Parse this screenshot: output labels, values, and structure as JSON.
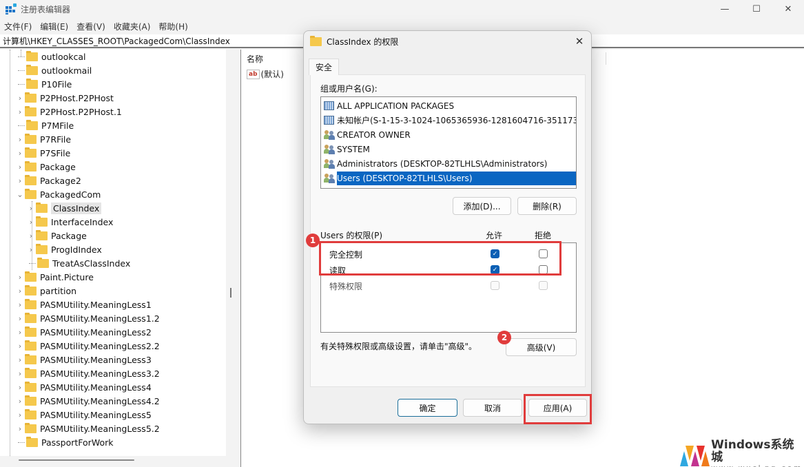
{
  "window": {
    "title": "注册表编辑器",
    "controls": {
      "minimize": "—",
      "maximize": "☐",
      "close": "✕"
    }
  },
  "menu": [
    "文件(F)",
    "编辑(E)",
    "查看(V)",
    "收藏夹(A)",
    "帮助(H)"
  ],
  "address": "计算机\\HKEY_CLASSES_ROOT\\PackagedCom\\ClassIndex",
  "tree": {
    "items": [
      {
        "label": "outlookcal",
        "level": 0,
        "expandable": false
      },
      {
        "label": "outlookmail",
        "level": 0,
        "expandable": false
      },
      {
        "label": "P10File",
        "level": 0,
        "expandable": false
      },
      {
        "label": "P2PHost.P2PHost",
        "level": 0,
        "expandable": true
      },
      {
        "label": "P2PHost.P2PHost.1",
        "level": 0,
        "expandable": true
      },
      {
        "label": "P7MFile",
        "level": 0,
        "expandable": false
      },
      {
        "label": "P7RFile",
        "level": 0,
        "expandable": true
      },
      {
        "label": "P7SFile",
        "level": 0,
        "expandable": true
      },
      {
        "label": "Package",
        "level": 0,
        "expandable": true
      },
      {
        "label": "Package2",
        "level": 0,
        "expandable": true
      },
      {
        "label": "PackagedCom",
        "level": 0,
        "expandable": true,
        "expanded": true
      },
      {
        "label": "ClassIndex",
        "level": 1,
        "expandable": true,
        "selected": true
      },
      {
        "label": "InterfaceIndex",
        "level": 1,
        "expandable": true
      },
      {
        "label": "Package",
        "level": 1,
        "expandable": true
      },
      {
        "label": "ProgIdIndex",
        "level": 1,
        "expandable": true
      },
      {
        "label": "TreatAsClassIndex",
        "level": 1,
        "expandable": false
      },
      {
        "label": "Paint.Picture",
        "level": 0,
        "expandable": true
      },
      {
        "label": "partition",
        "level": 0,
        "expandable": true
      },
      {
        "label": "PASMUtility.MeaningLess1",
        "level": 0,
        "expandable": true
      },
      {
        "label": "PASMUtility.MeaningLess1.2",
        "level": 0,
        "expandable": true
      },
      {
        "label": "PASMUtility.MeaningLess2",
        "level": 0,
        "expandable": true
      },
      {
        "label": "PASMUtility.MeaningLess2.2",
        "level": 0,
        "expandable": true
      },
      {
        "label": "PASMUtility.MeaningLess3",
        "level": 0,
        "expandable": true
      },
      {
        "label": "PASMUtility.MeaningLess3.2",
        "level": 0,
        "expandable": true
      },
      {
        "label": "PASMUtility.MeaningLess4",
        "level": 0,
        "expandable": true
      },
      {
        "label": "PASMUtility.MeaningLess4.2",
        "level": 0,
        "expandable": true
      },
      {
        "label": "PASMUtility.MeaningLess5",
        "level": 0,
        "expandable": true
      },
      {
        "label": "PASMUtility.MeaningLess5.2",
        "level": 0,
        "expandable": true
      },
      {
        "label": "PassportForWork",
        "level": 0,
        "expandable": false
      }
    ]
  },
  "values_pane": {
    "column_name": "名称",
    "rows": [
      {
        "icon": "ab",
        "name": "(默认)"
      }
    ]
  },
  "dialog": {
    "title": "ClassIndex 的权限",
    "close": "✕",
    "tab": "安全",
    "group_label": "组或用户名(G):",
    "users": [
      {
        "name": "ALL APPLICATION PACKAGES",
        "icon": "package-icon"
      },
      {
        "name": "未知帐户(S-1-15-3-1024-1065365936-1281604716-351173...",
        "icon": "package-icon"
      },
      {
        "name": "CREATOR OWNER",
        "icon": "group-icon"
      },
      {
        "name": "SYSTEM",
        "icon": "group-icon"
      },
      {
        "name": "Administrators (DESKTOP-82TLHLS\\Administrators)",
        "icon": "group-icon"
      },
      {
        "name": "Users (DESKTOP-82TLHLS\\Users)",
        "icon": "group-icon",
        "selected": true
      }
    ],
    "add_button": "添加(D)...",
    "remove_button": "删除(R)",
    "perm_label": "Users 的权限(P)",
    "allow_header": "允许",
    "deny_header": "拒绝",
    "permissions": [
      {
        "name": "完全控制",
        "allow": true,
        "deny": false,
        "disabled": false
      },
      {
        "name": "读取",
        "allow": true,
        "deny": false,
        "disabled": false
      },
      {
        "name": "特殊权限",
        "allow": false,
        "deny": false,
        "disabled": true
      }
    ],
    "advanced_hint": "有关特殊权限或高级设置，请单击\"高级\"。",
    "advanced_button": "高级(V)",
    "ok_button": "确定",
    "cancel_button": "取消",
    "apply_button": "应用(A)"
  },
  "annotations": {
    "badge1": "1",
    "badge2": "2",
    "highlight_color": "#e03c3c"
  },
  "watermark": {
    "title": "Windows系统城",
    "url": "www.wxcLgg.com"
  }
}
